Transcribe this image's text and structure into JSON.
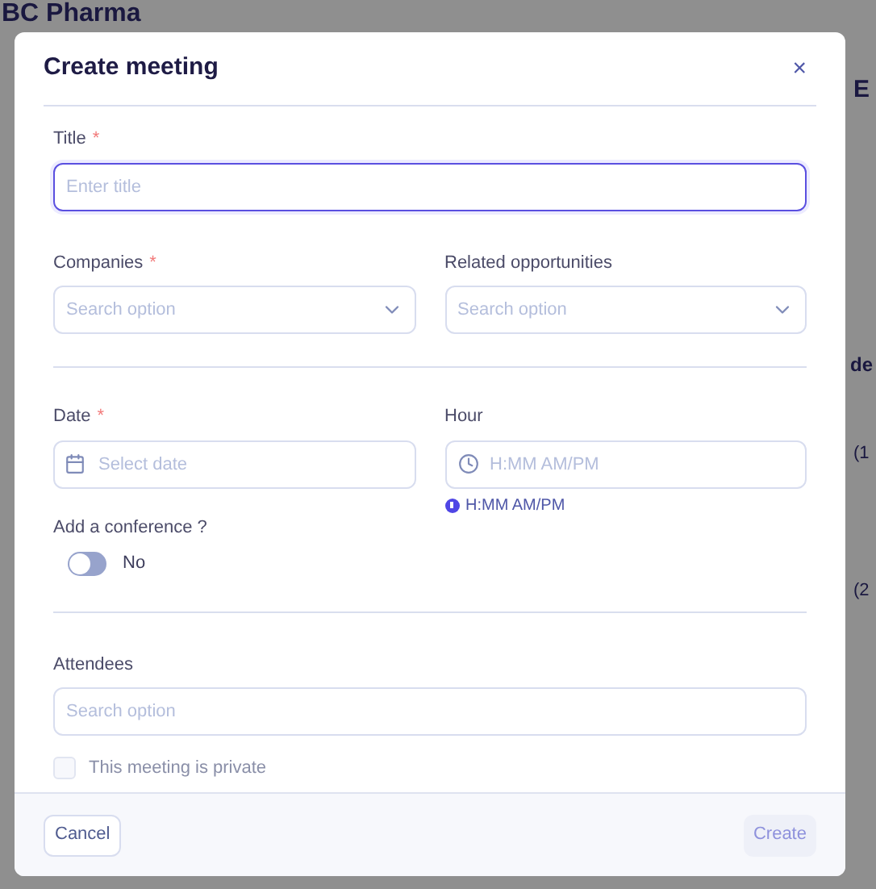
{
  "background": {
    "heading": "BC Pharma",
    "fragments": [
      {
        "text": "E"
      },
      {
        "text": "de"
      },
      {
        "text": "(1"
      },
      {
        "text": "(2"
      }
    ]
  },
  "dialog": {
    "title": "Create meeting",
    "close": "×",
    "title_field": {
      "label": "Title",
      "required_mark": "*",
      "placeholder": "Enter title",
      "focused": true
    },
    "companies": {
      "label": "Companies",
      "required_mark": "*",
      "placeholder": "Search option",
      "focused": false
    },
    "opportunities": {
      "label": "Related opportunities",
      "placeholder": "Search option",
      "focused": false
    },
    "date": {
      "label": "Date",
      "required_mark": "*",
      "placeholder": "Select date",
      "focused": false
    },
    "hour": {
      "label": "Hour",
      "placeholder": "H:MM AM/PM",
      "focused": false,
      "hint": "H:MM AM/PM"
    },
    "conference": {
      "label": "Add a conference ?",
      "on": false,
      "state_label": "No"
    },
    "attendees": {
      "label": "Attendees",
      "placeholder": "Search option",
      "focused": false
    },
    "private": {
      "label": "This meeting is private",
      "checked": false
    },
    "cancel": "Cancel",
    "create": {
      "label": "Create",
      "disabled": true
    }
  }
}
